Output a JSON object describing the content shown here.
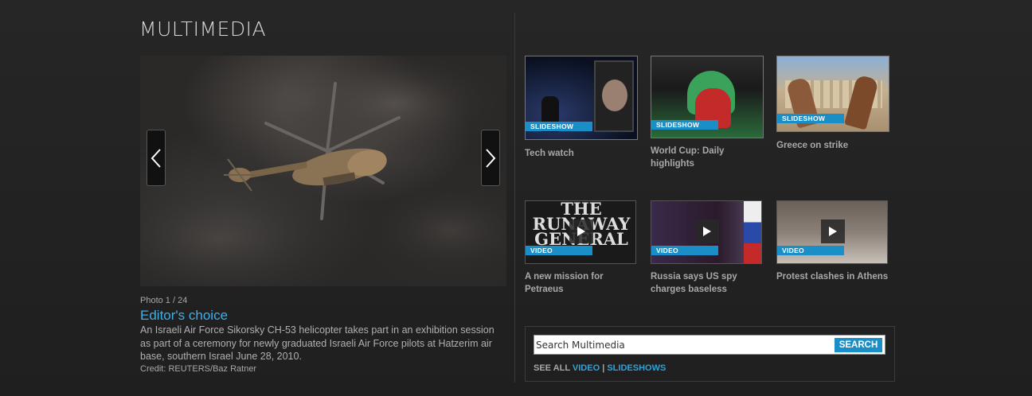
{
  "section": {
    "title": "MULTIMEDIA"
  },
  "featured": {
    "counter": "Photo 1 / 24",
    "title": "Editor's choice",
    "description": "An Israeli Air Force Sikorsky CH-53 helicopter takes part in an exhibition session as part of a ceremony for newly graduated Israeli Air Force pilots at Hatzerim air base, southern Israel June 28, 2010.",
    "credit": "Credit: REUTERS/Baz Ratner",
    "prev_icon": "chevron-left-icon",
    "next_icon": "chevron-right-icon"
  },
  "thumbnails": [
    {
      "tag": "SLIDESHOW",
      "caption": "Tech watch",
      "type": "slideshow"
    },
    {
      "tag": "SLIDESHOW",
      "caption": "World Cup: Daily highlights",
      "type": "slideshow"
    },
    {
      "tag": "SLIDESHOW",
      "caption": "Greece on strike",
      "type": "slideshow"
    },
    {
      "tag": "VIDEO",
      "caption": "A new mission for Petraeus",
      "type": "video",
      "image_text": "THE RUNAWAY GENERAL"
    },
    {
      "tag": "VIDEO",
      "caption": "Russia says US spy charges baseless",
      "type": "video"
    },
    {
      "tag": "VIDEO",
      "caption": "Protest clashes in Athens",
      "type": "video"
    }
  ],
  "search": {
    "placeholder": "Search Multimedia",
    "button": "SEARCH",
    "see_all_label": "SEE ALL",
    "video_link": "VIDEO",
    "separator": "|",
    "slideshows_link": "SLIDESHOWS"
  },
  "colors": {
    "accent": "#1a8fc7",
    "link": "#3fb0e6",
    "background": "#222222"
  }
}
